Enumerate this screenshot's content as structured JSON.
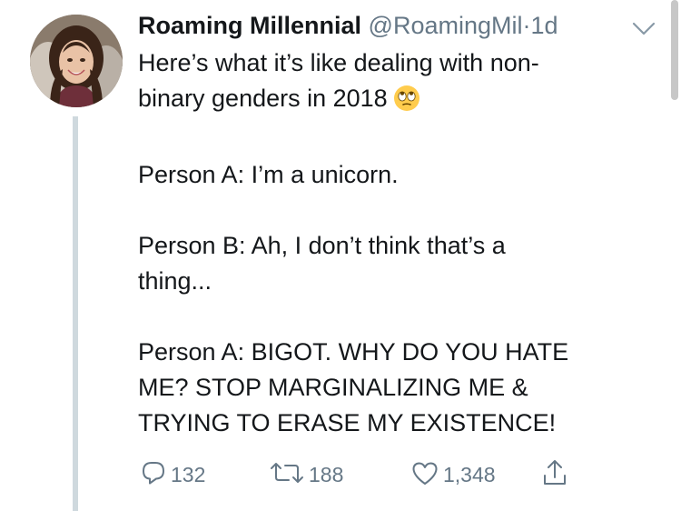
{
  "tweet": {
    "author_name": "Roaming Millennial",
    "author_handle": "@RoamingMil",
    "separator": "·",
    "time": "1d",
    "text_lines": {
      "l1": "Here’s what it’s like dealing with non-",
      "l2": "binary genders in 2018",
      "l3": "Person A: I’m a unicorn.",
      "l4": "Person B: Ah, I don’t think that’s a",
      "l5": "thing...",
      "l6": "Person A: BIGOT. WHY DO YOU HATE",
      "l7": "ME? STOP MARGINALIZING ME &",
      "l8": "TRYING TO ERASE MY EXISTENCE!"
    },
    "emoji": "face-with-rolling-eyes",
    "actions": {
      "replies": "132",
      "retweets": "188",
      "likes": "1,348"
    }
  },
  "colors": {
    "text": "#14171a",
    "secondary": "#657786",
    "thread_line": "#cfd9de"
  },
  "icons": [
    "reply-icon",
    "retweet-icon",
    "like-icon",
    "share-icon",
    "caret-down-icon"
  ]
}
